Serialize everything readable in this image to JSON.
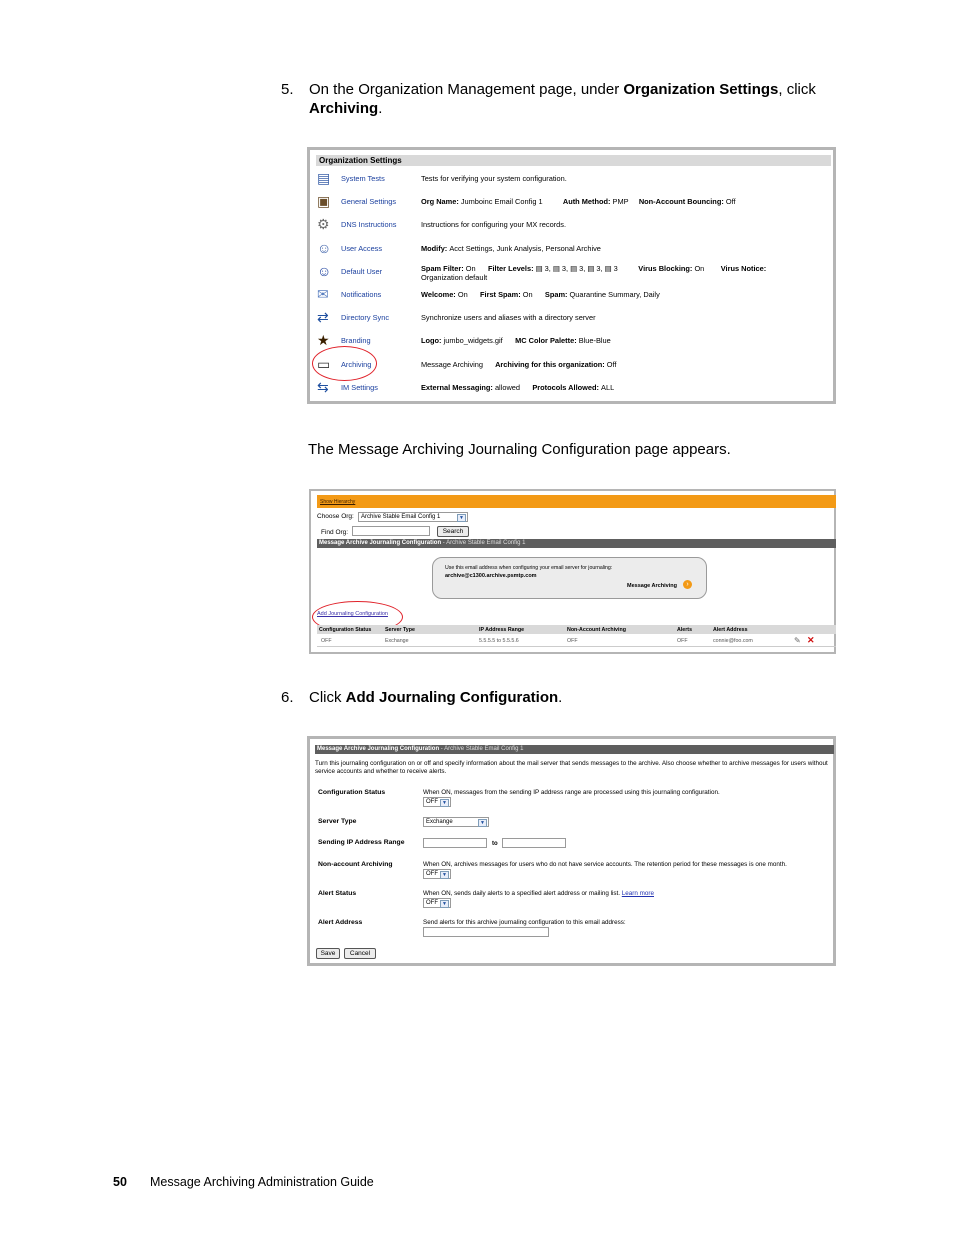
{
  "step5": {
    "number": "5.",
    "prefix": "On the Organization Management page, under ",
    "bold1": "Organization Settings",
    "middle": ", click ",
    "bold2": "Archiving",
    "suffix": "."
  },
  "org_settings": {
    "header": "Organization Settings",
    "rows": [
      {
        "link": "System Tests",
        "desc": [
          {
            "t": "Tests for verifying your system configuration.",
            "b": false
          }
        ]
      },
      {
        "link": "General Settings",
        "desc": [
          {
            "t": "Org Name: ",
            "b": true
          },
          {
            "t": "Jumboinc Email Config 1",
            "b": false
          },
          {
            "t": "          Auth Method: ",
            "b": true
          },
          {
            "t": "PMP",
            "b": false
          },
          {
            "t": "     Non-Account Bouncing: ",
            "b": true
          },
          {
            "t": "Off",
            "b": false
          }
        ]
      },
      {
        "link": "DNS Instructions",
        "desc": [
          {
            "t": "Instructions for configuring your MX records.",
            "b": false
          }
        ]
      },
      {
        "link": "User Access",
        "desc": [
          {
            "t": "Modify: ",
            "b": true
          },
          {
            "t": "Acct Settings, Junk Analysis, Personal Archive",
            "b": false
          }
        ]
      },
      {
        "link": "Default User",
        "desc": [
          {
            "t": "Spam Filter: ",
            "b": true
          },
          {
            "t": "On",
            "b": false
          },
          {
            "t": "      Filter Levels: ",
            "b": true
          },
          {
            "t": "▤ 3, ▤ 3, ▤ 3, ▤ 3, ▤ 3",
            "b": false
          },
          {
            "t": "          Virus Blocking: ",
            "b": true
          },
          {
            "t": "On",
            "b": false
          },
          {
            "t": "        Virus Notice:",
            "b": true
          }
        ],
        "desc2": "Organization default"
      },
      {
        "link": "Notifications",
        "desc": [
          {
            "t": "Welcome: ",
            "b": true
          },
          {
            "t": "On",
            "b": false
          },
          {
            "t": "      First Spam: ",
            "b": true
          },
          {
            "t": "On",
            "b": false
          },
          {
            "t": "      Spam: ",
            "b": true
          },
          {
            "t": "Quarantine Summary, Daily",
            "b": false
          }
        ]
      },
      {
        "link": "Directory Sync",
        "desc": [
          {
            "t": "Synchronize users and aliases with a directory server",
            "b": false
          }
        ]
      },
      {
        "link": "Branding",
        "desc": [
          {
            "t": "Logo: ",
            "b": true
          },
          {
            "t": "jumbo_widgets.gif",
            "b": false
          },
          {
            "t": "      MC Color Palette: ",
            "b": true
          },
          {
            "t": "Blue-Blue",
            "b": false
          }
        ]
      },
      {
        "link": "Archiving",
        "desc": [
          {
            "t": "Message Archiving",
            "b": false
          },
          {
            "t": "      Archiving for this organization: ",
            "b": true
          },
          {
            "t": "Off",
            "b": false
          }
        ]
      },
      {
        "link": "IM Settings",
        "desc": [
          {
            "t": "External Messaging: ",
            "b": true
          },
          {
            "t": "allowed",
            "b": false
          },
          {
            "t": "      Protocols Allowed: ",
            "b": true
          },
          {
            "t": "ALL",
            "b": false
          }
        ]
      }
    ]
  },
  "para_appears": "The Message Archiving Journaling Configuration page appears.",
  "journal_page": {
    "show_hierarchy": "Show Hierarchy",
    "choose_org_label": "Choose Org:",
    "choose_org_value": "Archive Stable Email Config 1",
    "find_org_label": "Find Org:",
    "search_button": "Search",
    "bar_title": "Message Archive Journaling Configuration",
    "bar_subtitle": " - Archive Stable Email Config 1",
    "bubble_line1": "Use this email address when configuring your email server for journaling:",
    "bubble_email": "archive@c1300.archive.psmtp.com",
    "bubble_link": "Message Archiving",
    "add_link": "Add Journaling Configuration",
    "columns": [
      "Configuration Status",
      "Server Type",
      "IP Address Range",
      "Non-Account Archiving",
      "Alerts",
      "Alert Address"
    ],
    "row": [
      "OFF",
      "Exchange",
      "5.5.5.5  to  5.5.5.6",
      "OFF",
      "OFF",
      "connie@foo.com"
    ]
  },
  "step6": {
    "number": "6.",
    "prefix": "Click ",
    "bold": "Add Journaling Configuration",
    "suffix": "."
  },
  "config_form": {
    "bar_title": "Message Archive Journaling Configuration",
    "bar_subtitle": " - Archive Stable Email Config 1",
    "intro": "Turn this journaling configuration on or off and specify information about the mail server that sends messages to the archive. Also choose whether to archive messages for users without service accounts and whether to receive alerts.",
    "config_status_label": "Configuration Status",
    "config_status_desc": "When ON, messages from the sending IP address range are processed using this journaling configuration.",
    "config_status_value": "OFF",
    "server_type_label": "Server Type",
    "server_type_value": "Exchange",
    "ip_range_label": "Sending IP Address Range",
    "ip_to": "to",
    "non_account_label": "Non-account Archiving",
    "non_account_desc": "When ON, archives messages for users who do not have service accounts. The retention period for these messages is one month.",
    "non_account_value": "OFF",
    "alert_status_label": "Alert Status",
    "alert_status_desc": "When ON, sends daily alerts to a specified alert address or mailing list.",
    "learn_more": "Learn more",
    "alert_status_value": "OFF",
    "alert_address_label": "Alert Address",
    "alert_address_desc": "Send alerts for this archive journaling configuration to this email address:",
    "save_button": "Save",
    "cancel_button": "Cancel"
  },
  "footer": {
    "page_number": "50",
    "title": "Message Archiving Administration Guide"
  }
}
